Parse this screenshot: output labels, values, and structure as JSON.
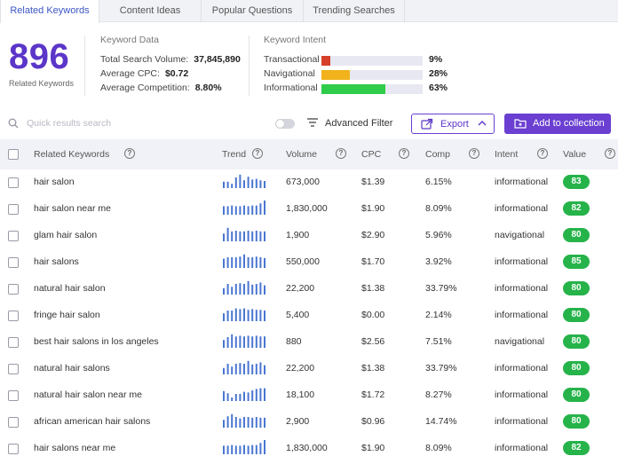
{
  "tabs": [
    "Related Keywords",
    "Content Ideas",
    "Popular Questions",
    "Trending Searches"
  ],
  "summary": {
    "count": "896",
    "count_label": "Related Keywords",
    "keyword_data_title": "Keyword Data",
    "total_search_volume_label": "Total Search Volume:",
    "total_search_volume": "37,845,890",
    "avg_cpc_label": "Average CPC:",
    "avg_cpc": "$0.72",
    "avg_comp_label": "Average Competition:",
    "avg_comp": "8.80%",
    "intent_title": "Keyword Intent",
    "intents": [
      {
        "name": "Transactional",
        "pct": "9%",
        "value": 0.09,
        "color": "#d6402a"
      },
      {
        "name": "Navigational",
        "pct": "28%",
        "value": 0.28,
        "color": "#f1b21b"
      },
      {
        "name": "Informational",
        "pct": "63%",
        "value": 0.63,
        "color": "#2fcc4b"
      }
    ]
  },
  "toolbar": {
    "search_placeholder": "Quick results search",
    "advanced_filter": "Advanced Filter",
    "export": "Export",
    "add_to_collection": "Add to collection"
  },
  "columns": {
    "keyword": "Related Keywords",
    "trend": "Trend",
    "volume": "Volume",
    "cpc": "CPC",
    "comp": "Comp",
    "intent": "Intent",
    "value": "Value"
  },
  "rows": [
    {
      "keyword": "hair salon",
      "volume": "673,000",
      "cpc": "$1.39",
      "comp": "6.15%",
      "intent": "informational",
      "value": "83",
      "trend": [
        0.45,
        0.45,
        0.3,
        0.75,
        0.95,
        0.55,
        0.8,
        0.6,
        0.65,
        0.55,
        0.5
      ]
    },
    {
      "keyword": "hair salon near me",
      "volume": "1,830,000",
      "cpc": "$1.90",
      "comp": "8.09%",
      "intent": "informational",
      "value": "82",
      "trend": [
        0.6,
        0.6,
        0.65,
        0.6,
        0.6,
        0.65,
        0.6,
        0.65,
        0.65,
        0.8,
        1.0
      ]
    },
    {
      "keyword": "glam hair salon",
      "volume": "1,900",
      "cpc": "$2.90",
      "comp": "5.96%",
      "intent": "navigational",
      "value": "80",
      "trend": [
        0.55,
        0.95,
        0.7,
        0.75,
        0.7,
        0.7,
        0.75,
        0.7,
        0.75,
        0.7,
        0.7
      ]
    },
    {
      "keyword": "hair salons",
      "volume": "550,000",
      "cpc": "$1.70",
      "comp": "3.92%",
      "intent": "informational",
      "value": "85",
      "trend": [
        0.65,
        0.75,
        0.75,
        0.75,
        0.8,
        0.95,
        0.75,
        0.75,
        0.8,
        0.75,
        0.7
      ]
    },
    {
      "keyword": "natural hair salon",
      "volume": "22,200",
      "cpc": "$1.38",
      "comp": "33.79%",
      "intent": "informational",
      "value": "80",
      "trend": [
        0.45,
        0.75,
        0.55,
        0.75,
        0.8,
        0.75,
        0.95,
        0.7,
        0.75,
        0.85,
        0.65
      ]
    },
    {
      "keyword": "fringe hair salon",
      "volume": "5,400",
      "cpc": "$0.00",
      "comp": "2.14%",
      "intent": "informational",
      "value": "80",
      "trend": [
        0.55,
        0.75,
        0.75,
        0.9,
        0.85,
        0.9,
        0.8,
        0.85,
        0.8,
        0.8,
        0.75
      ]
    },
    {
      "keyword": "best hair salons in los angeles",
      "volume": "880",
      "cpc": "$2.56",
      "comp": "7.51%",
      "intent": "navigational",
      "value": "80",
      "trend": [
        0.55,
        0.75,
        0.95,
        0.8,
        0.85,
        0.8,
        0.85,
        0.8,
        0.85,
        0.8,
        0.8
      ]
    },
    {
      "keyword": "natural hair salons",
      "volume": "22,200",
      "cpc": "$1.38",
      "comp": "33.79%",
      "intent": "informational",
      "value": "80",
      "trend": [
        0.45,
        0.75,
        0.55,
        0.75,
        0.8,
        0.75,
        0.95,
        0.7,
        0.75,
        0.85,
        0.65
      ]
    },
    {
      "keyword": "natural hair salon near me",
      "volume": "18,100",
      "cpc": "$1.72",
      "comp": "8.27%",
      "intent": "informational",
      "value": "80",
      "trend": [
        0.7,
        0.55,
        0.25,
        0.5,
        0.5,
        0.65,
        0.6,
        0.75,
        0.85,
        0.9,
        0.9
      ]
    },
    {
      "keyword": "african american hair salons",
      "volume": "2,900",
      "cpc": "$0.96",
      "comp": "14.74%",
      "intent": "informational",
      "value": "80",
      "trend": [
        0.55,
        0.8,
        0.95,
        0.75,
        0.65,
        0.75,
        0.75,
        0.7,
        0.75,
        0.7,
        0.7
      ]
    },
    {
      "keyword": "hair salons near me",
      "volume": "1,830,000",
      "cpc": "$1.90",
      "comp": "8.09%",
      "intent": "informational",
      "value": "82",
      "trend": [
        0.6,
        0.6,
        0.65,
        0.6,
        0.6,
        0.65,
        0.6,
        0.65,
        0.65,
        0.8,
        1.0
      ]
    }
  ]
}
